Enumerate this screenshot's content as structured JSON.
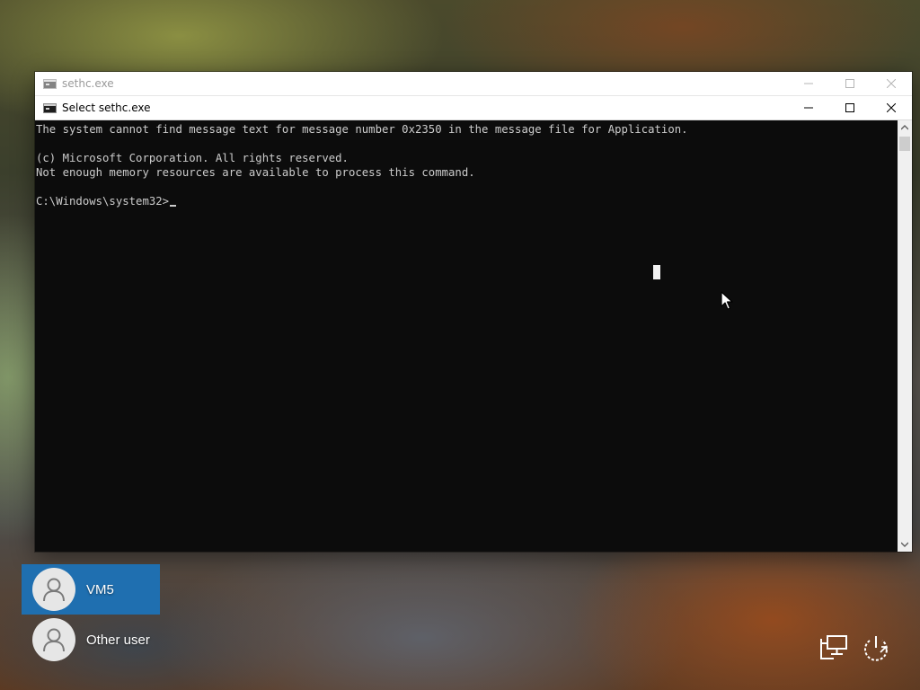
{
  "background_window": {
    "title": "sethc.exe",
    "icon": "console-icon",
    "controls": [
      "minimize-icon",
      "maximize-icon",
      "close-icon"
    ]
  },
  "console_window": {
    "title": "Select sethc.exe",
    "icon": "console-icon",
    "controls": [
      "minimize-icon",
      "maximize-icon",
      "close-icon"
    ],
    "lines": [
      "The system cannot find message text for message number 0x2350 in the message file for Application.",
      "",
      "(c) Microsoft Corporation. All rights reserved.",
      "Not enough memory resources are available to process this command.",
      "",
      "C:\\Windows\\system32>"
    ],
    "colors": {
      "background": "#0c0c0c",
      "text": "#cccccc"
    }
  },
  "login_screen": {
    "users": [
      {
        "name": "VM5",
        "selected": true
      },
      {
        "name": "Other user",
        "selected": false
      }
    ],
    "accent_color": "#1f6fb0",
    "system_icons": [
      "network-icon",
      "power-icon"
    ]
  }
}
